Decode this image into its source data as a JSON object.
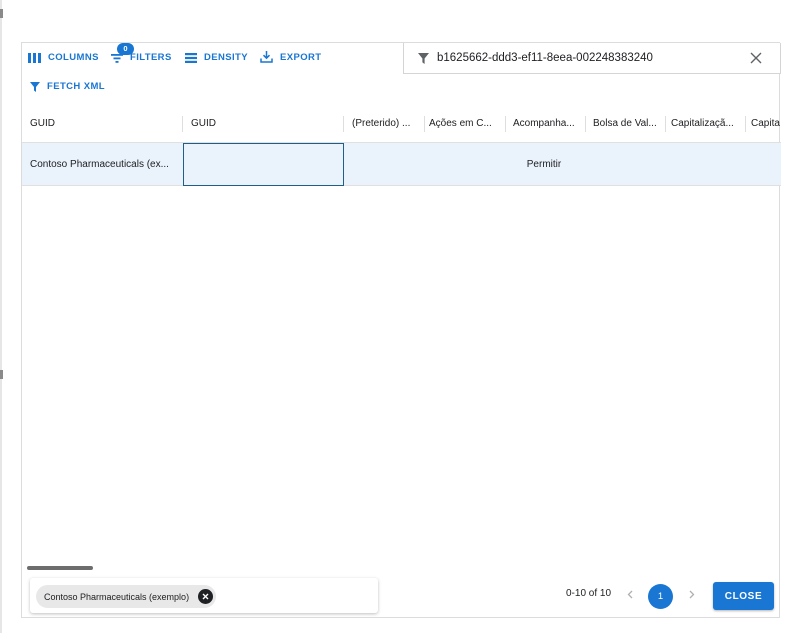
{
  "toolbar": {
    "columns_label": "COLUMNS",
    "filters_label": "FILTERS",
    "filters_count": "0",
    "density_label": "DENSITY",
    "export_label": "EXPORT",
    "fetch_xml_label": "FETCH XML"
  },
  "search": {
    "value": "b1625662-ddd3-ef11-8eea-002248383240"
  },
  "grid": {
    "columns": [
      "GUID",
      "GUID",
      "(Preterido) ...",
      "Ações em C...",
      "Acompanha...",
      "Bolsa de Val...",
      "Capitalizaçã...",
      "Capita"
    ],
    "rows": [
      {
        "name": "Contoso Pharmaceuticals (ex...",
        "guid": "",
        "value": "Permitir"
      }
    ]
  },
  "footer": {
    "chip_label": "Contoso Pharmaceuticals (exemplo)",
    "pager_range": "0-10 of 10",
    "current_page": "1",
    "close_label": "CLOSE"
  },
  "colors": {
    "accent": "#1976d2",
    "row_selected": "#eaf2fb",
    "cell_focus_border": "#1d5f8a"
  }
}
